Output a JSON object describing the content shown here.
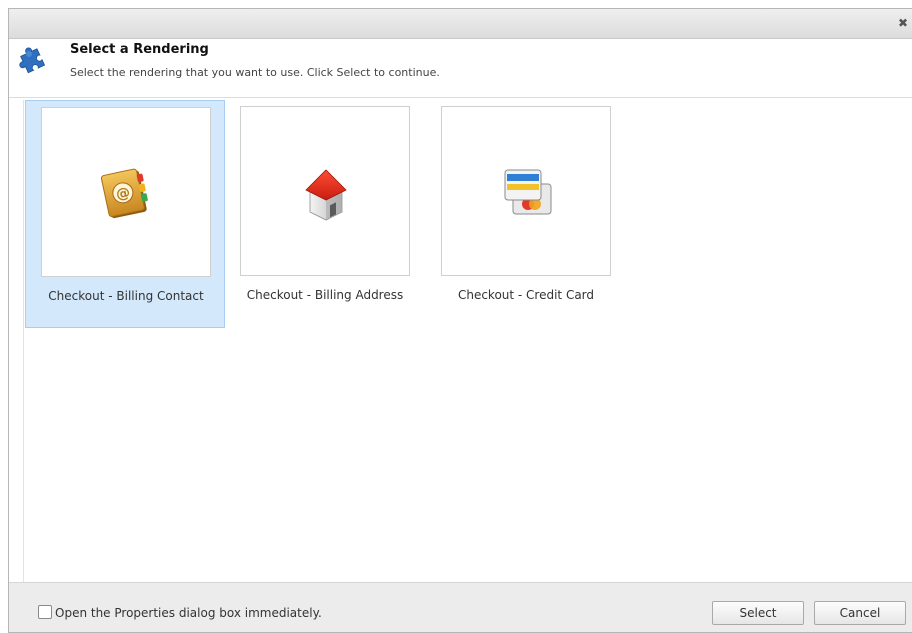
{
  "dialog": {
    "close_label": "✖",
    "title": "Select a Rendering",
    "subtitle": "Select the rendering that you want to use. Click Select to continue.",
    "header_icon": "puzzle-piece-icon"
  },
  "renderings": [
    {
      "label": "Checkout - Billing Contact",
      "icon": "address-book-icon",
      "selected": true
    },
    {
      "label": "Checkout - Billing Address",
      "icon": "house-icon",
      "selected": false
    },
    {
      "label": "Checkout - Credit Card",
      "icon": "credit-card-icon",
      "selected": false
    }
  ],
  "footer": {
    "checkbox_label": "Open the Properties dialog box immediately.",
    "checkbox_checked": false,
    "select_label": "Select",
    "cancel_label": "Cancel"
  },
  "colors": {
    "selection": "#d4e8fb",
    "selection_border": "#a9cdf0",
    "puzzle": "#2f6fc0"
  }
}
